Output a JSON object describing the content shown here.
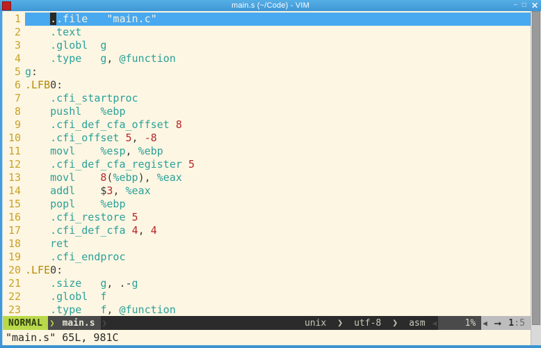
{
  "window": {
    "title": "main.s (~/Code) - VIM",
    "icon": "vim-icon",
    "controls": {
      "minimize": "–",
      "maximize": "□",
      "close": "✕"
    }
  },
  "editor": {
    "lines": [
      {
        "num": "1",
        "text": ".file   \"main.c\""
      },
      {
        "num": "2",
        "text": ".text"
      },
      {
        "num": "3",
        "text": ".globl  g"
      },
      {
        "num": "4",
        "text": ".type   g, @function"
      },
      {
        "num": "5",
        "text": "g:"
      },
      {
        "num": "6",
        "text": ".LFB0:"
      },
      {
        "num": "7",
        "text": ".cfi_startproc"
      },
      {
        "num": "8",
        "text": "pushl   %ebp"
      },
      {
        "num": "9",
        "text": ".cfi_def_cfa_offset 8"
      },
      {
        "num": "10",
        "text": ".cfi_offset 5, -8"
      },
      {
        "num": "11",
        "text": "movl    %esp, %ebp"
      },
      {
        "num": "12",
        "text": ".cfi_def_cfa_register 5"
      },
      {
        "num": "13",
        "text": "movl    8(%ebp), %eax"
      },
      {
        "num": "14",
        "text": "addl    $3, %eax"
      },
      {
        "num": "15",
        "text": "popl    %ebp"
      },
      {
        "num": "16",
        "text": ".cfi_restore 5"
      },
      {
        "num": "17",
        "text": ".cfi_def_cfa 4, 4"
      },
      {
        "num": "18",
        "text": "ret"
      },
      {
        "num": "19",
        "text": ".cfi_endproc"
      },
      {
        "num": "20",
        "text": ".LFE0:"
      },
      {
        "num": "21",
        "text": ".size   g, .-g"
      },
      {
        "num": "22",
        "text": ".globl  f"
      },
      {
        "num": "23",
        "text": ".type   f, @function"
      }
    ],
    "cursor_line": 1,
    "cursor_char": ".",
    "tokens": {
      "l1": {
        "a": ".file",
        "b": "   ",
        "c": "\"main.c\""
      },
      "l2": {
        "a": ".text"
      },
      "l3": {
        "a": ".globl",
        "b": "  ",
        "c": "g"
      },
      "l4": {
        "a": ".type",
        "b": "   ",
        "c": "g",
        "d": ", ",
        "e": "@function"
      },
      "l5": {
        "a": "g",
        "b": ":"
      },
      "l6": {
        "a": ".LFB",
        "b": "0",
        "c": ":"
      },
      "l7": {
        "a": ".cfi_startproc"
      },
      "l8": {
        "a": "pushl",
        "b": "   ",
        "c": "%ebp"
      },
      "l9": {
        "a": ".cfi_def_cfa_offset",
        "b": " ",
        "c": "8"
      },
      "l10": {
        "a": ".cfi_offset",
        "b": " ",
        "c": "5",
        "d": ", ",
        "e": "-8"
      },
      "l11": {
        "a": "movl",
        "b": "    ",
        "c": "%esp",
        "d": ", ",
        "e": "%ebp"
      },
      "l12": {
        "a": ".cfi_def_cfa_register",
        "b": " ",
        "c": "5"
      },
      "l13": {
        "a": "movl",
        "b": "    ",
        "c": "8",
        "d": "(",
        "e": "%ebp",
        "f": "), ",
        "g": "%eax"
      },
      "l14": {
        "a": "addl",
        "b": "    ",
        "c": "$",
        "d": "3",
        "e": ", ",
        "f": "%eax"
      },
      "l15": {
        "a": "popl",
        "b": "    ",
        "c": "%ebp"
      },
      "l16": {
        "a": ".cfi_restore",
        "b": " ",
        "c": "5"
      },
      "l17": {
        "a": ".cfi_def_cfa",
        "b": " ",
        "c": "4",
        "d": ", ",
        "e": "4"
      },
      "l18": {
        "a": "ret"
      },
      "l19": {
        "a": ".cfi_endproc"
      },
      "l20": {
        "a": ".LFE",
        "b": "0",
        "c": ":"
      },
      "l21": {
        "a": ".size",
        "b": "   ",
        "c": "g",
        "d": ", ",
        "e": ".-",
        "f": "g"
      },
      "l22": {
        "a": ".globl",
        "b": "  ",
        "c": "f"
      },
      "l23": {
        "a": ".type",
        "b": "   ",
        "c": "f",
        "d": ", ",
        "e": "@function"
      }
    }
  },
  "statusline": {
    "mode": "NORMAL",
    "separator_filled": "❯",
    "separator_thin": "❯",
    "filename": "main.s",
    "fileformat": "unix",
    "encoding": "utf-8",
    "filetype": "asm",
    "percent": "1%",
    "position_glyph": "⭢",
    "line": "1",
    "colon": ":",
    "column": "5",
    "arrow_left": "◀"
  },
  "cmdline": {
    "message": "\"main.s\" 65L, 981C"
  },
  "colors": {
    "titlebar": "#3f97d6",
    "background": "#fdf6e3",
    "cursorline": "#49a9f0",
    "mode_bg": "#b9d94a",
    "linenumber": "#c9a227",
    "directive": "#2aa198",
    "number": "#b5262b",
    "label": "#b58900"
  }
}
